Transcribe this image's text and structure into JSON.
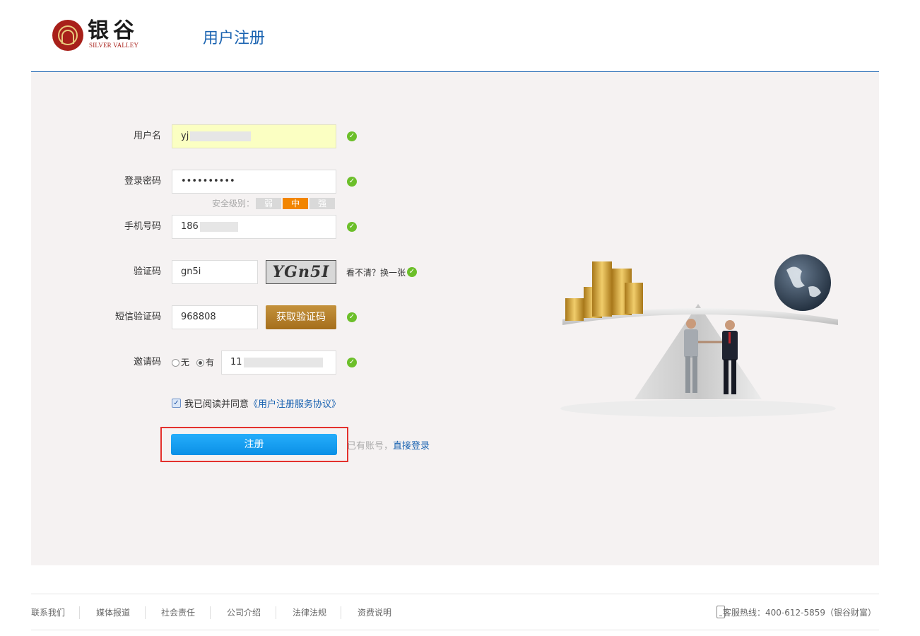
{
  "header": {
    "logo_cn": "银谷",
    "logo_en": "SILVER VALLEY",
    "page_title": "用户注册"
  },
  "form": {
    "username": {
      "label": "用户名",
      "value": "yj"
    },
    "password": {
      "label": "登录密码",
      "value": "••••••••••"
    },
    "strength": {
      "label": "安全级别：",
      "levels": [
        "弱",
        "中",
        "强"
      ],
      "active": "中"
    },
    "phone": {
      "label": "手机号码",
      "value": "186"
    },
    "captcha": {
      "label": "验证码",
      "value": "gn5i",
      "image_text": "YGn5I",
      "refresh": "看不清？换一张"
    },
    "sms": {
      "label": "短信验证码",
      "value": "968808",
      "button": "获取验证码"
    },
    "invite": {
      "label": "邀请码",
      "option_none": "无",
      "option_yes": "有",
      "selected": "有",
      "value": "11"
    },
    "agree": {
      "checked": true,
      "text": "我已阅读并同意",
      "link": "《用户注册服务协议》"
    },
    "submit": "注册",
    "login_hint": "已有账号，",
    "login_link": "直接登录"
  },
  "footer": {
    "links": [
      "联系我们",
      "媒体报道",
      "社会责任",
      "公司介绍",
      "法律法规",
      "资费说明"
    ],
    "hotline": "客服热线：400-612-5859（银谷财富）"
  },
  "colors": {
    "brand_blue": "#1a63b1",
    "ok_green": "#6cbf2a",
    "strength_active": "#f28500",
    "sms_button": "#b07a26",
    "submit_button": "#1a9ff0",
    "highlight_border": "#e3312d"
  },
  "icons": [
    "check-icon",
    "phone-icon",
    "checkbox-icon"
  ]
}
